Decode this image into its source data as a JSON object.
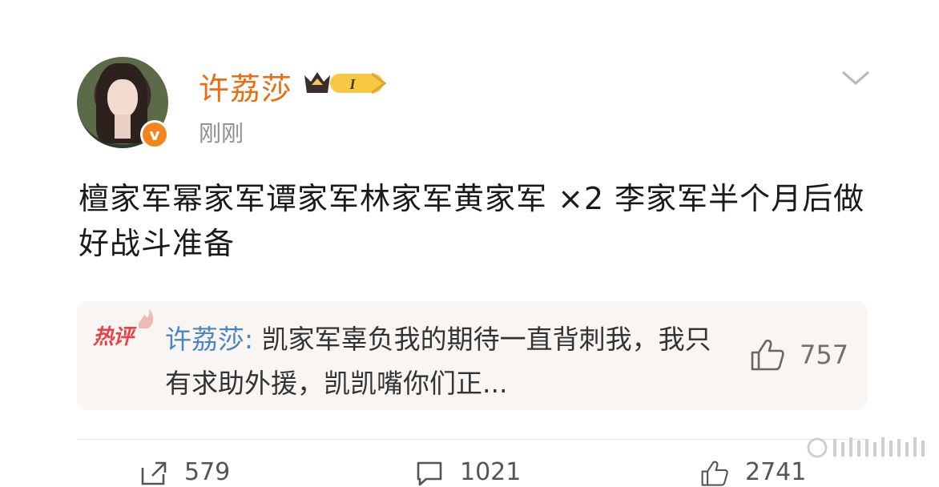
{
  "post": {
    "username": "许荔莎",
    "vip_level": "I",
    "verified_mark": "v",
    "time": "刚刚",
    "content": "檀家军幂家军谭家军林家军黄家军 ×2 李家军半个月后做好战斗准备"
  },
  "hot_comment": {
    "tag": "热评",
    "username": "许荔莎",
    "separator": ": ",
    "text": "凯家军辜负我的期待一直背刺我，我只有求助外援，凯凯嘴你们正...",
    "likes": "757"
  },
  "actions": {
    "repost_count": "579",
    "comment_count": "1021",
    "like_count": "2741"
  },
  "colors": {
    "username": "#e96e12",
    "link": "#4a86c6",
    "hot_tag": "#e8434b",
    "verified_badge": "#f5841f"
  },
  "icons": [
    "verified-badge-icon",
    "vip-crown-icon",
    "chevron-down-icon",
    "hot-flame-icon",
    "thumbs-up-icon",
    "repost-icon",
    "comment-icon"
  ]
}
